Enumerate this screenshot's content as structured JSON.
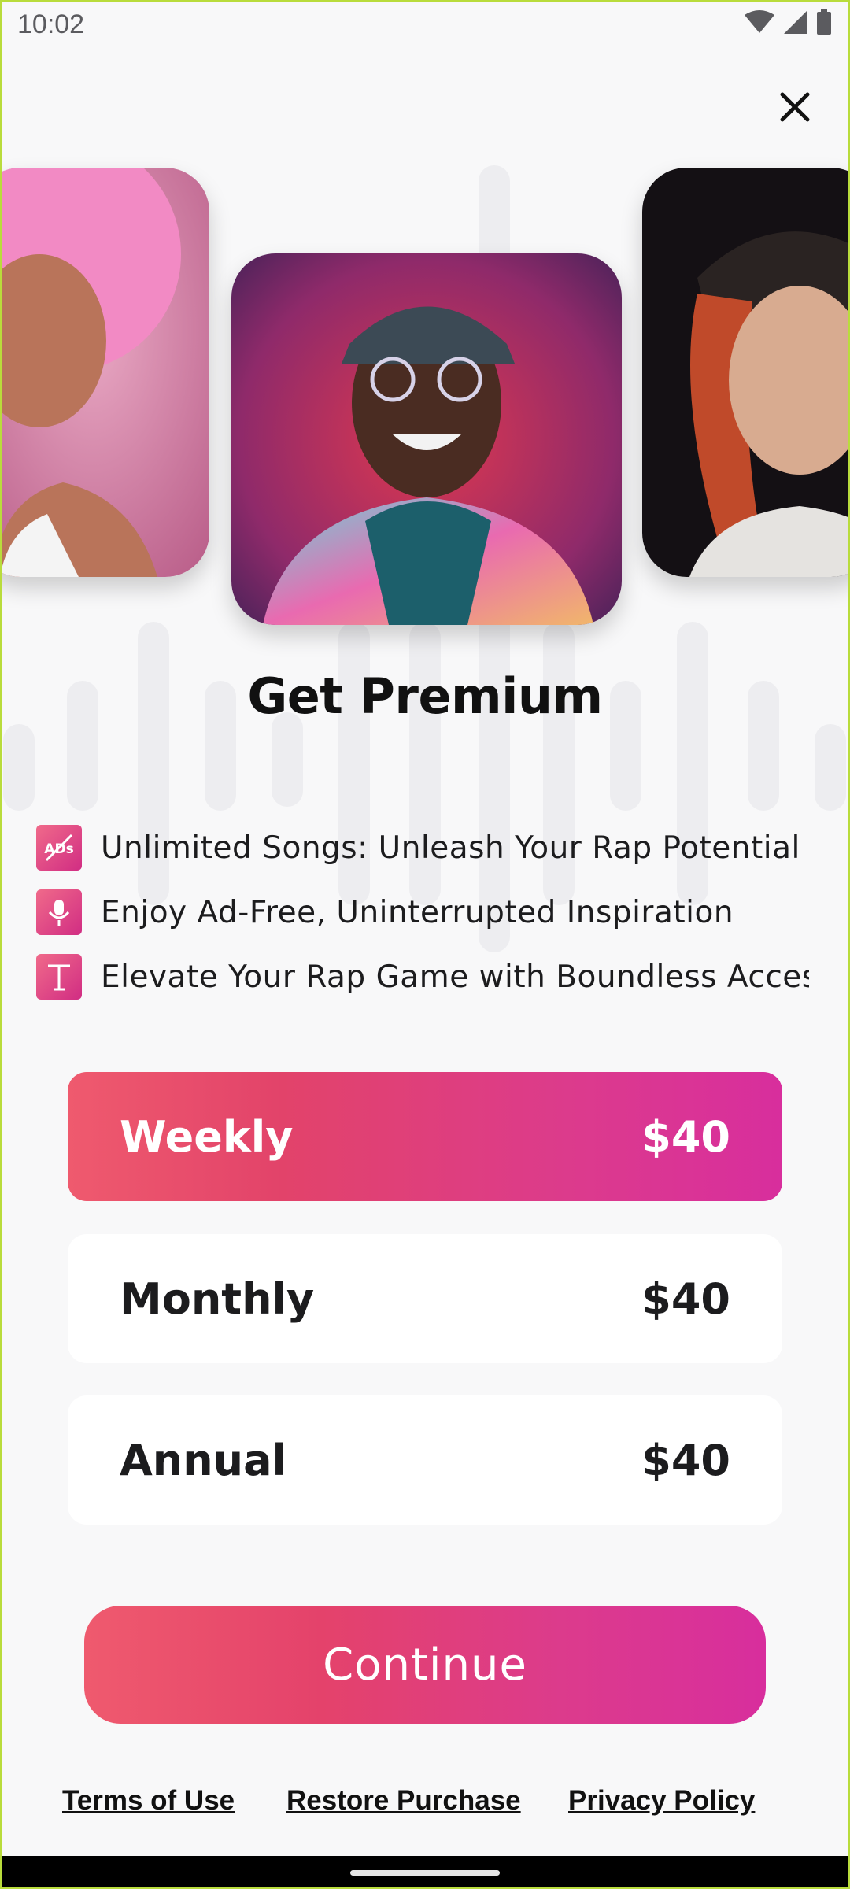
{
  "status_bar": {
    "time": "10:02",
    "icons": [
      "wifi-icon",
      "signal-icon",
      "battery-icon"
    ]
  },
  "close_icon": "close-icon",
  "title": "Get Premium",
  "features": [
    {
      "icon": "no-ads-icon",
      "text": "Unlimited Songs: Unleash Your Rap Potential"
    },
    {
      "icon": "microphone-icon",
      "text": "Enjoy Ad-Free, Uninterrupted Inspiration"
    },
    {
      "icon": "text-icon",
      "text": "Elevate Your Rap Game with Boundless Access"
    }
  ],
  "plans": [
    {
      "label": "Weekly",
      "price": "$40",
      "selected": true
    },
    {
      "label": "Monthly",
      "price": "$40",
      "selected": false
    },
    {
      "label": "Annual",
      "price": "$40",
      "selected": false
    }
  ],
  "continue_label": "Continue",
  "footer": {
    "terms": "Terms of Use",
    "restore": "Restore Purchase",
    "privacy": "Privacy Policy"
  },
  "colors": {
    "accent_start": "#ef5a6e",
    "accent_end": "#d82e9d",
    "background": "#f8f8f9"
  }
}
